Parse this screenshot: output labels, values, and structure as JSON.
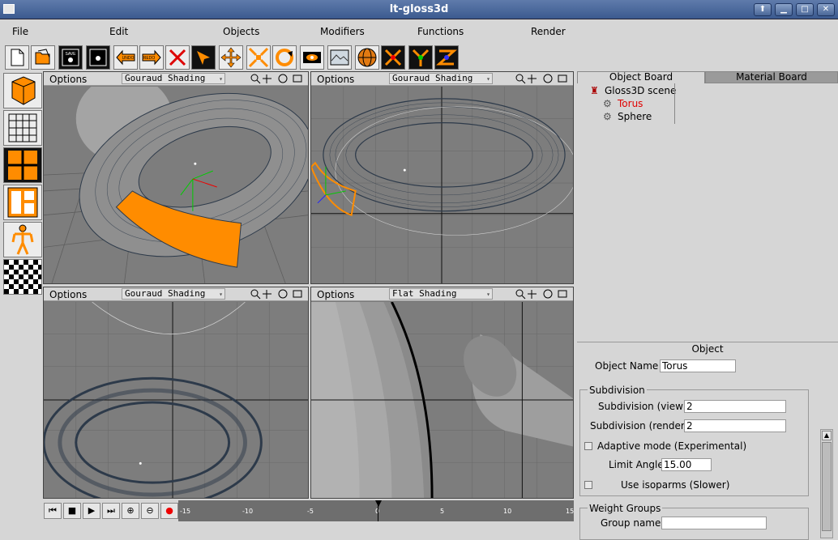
{
  "window": {
    "title": "lt-gloss3d"
  },
  "menubar": {
    "items": [
      "File",
      "Edit",
      "Objects",
      "Modifiers",
      "Functions",
      "Render"
    ]
  },
  "toolbar": {
    "icons": [
      "new-file-icon",
      "open-file-icon",
      "save-file-icon",
      "save-as-icon",
      "undo-icon",
      "redo-icon",
      "delete-icon",
      "pick-icon",
      "move-icon",
      "scale-icon",
      "rotate-icon",
      "render-view-icon",
      "render-final-icon",
      "sphere-render-icon",
      "x-axis-icon",
      "y-axis-icon",
      "z-axis-icon"
    ],
    "undo_label": "UNDO",
    "redo_label": "REDO",
    "save_label": "SAVE"
  },
  "lefttools": {
    "icons": [
      "box-primitive-icon",
      "grid-view-icon",
      "four-views-icon",
      "layout-views-icon",
      "skeleton-icon",
      "checker-material-icon"
    ]
  },
  "viewports": [
    {
      "options": "Options",
      "shading": "Gouraud Shading"
    },
    {
      "options": "Options",
      "shading": "Gouraud Shading"
    },
    {
      "options": "Options",
      "shading": "Gouraud Shading"
    },
    {
      "options": "Options",
      "shading": "Flat Shading"
    }
  ],
  "timeline": {
    "ticks": [
      "-15",
      "-10",
      "-5",
      "0",
      "5",
      "10",
      "15"
    ]
  },
  "rightpanel": {
    "tabs": [
      "Object Board",
      "Material Board"
    ],
    "tree": {
      "scene": "Gloss3D scene",
      "items": [
        "Torus",
        "Sphere"
      ]
    },
    "object": {
      "header": "Object",
      "name_label": "Object Name",
      "name_value": "Torus",
      "subdivision_title": "Subdivision",
      "subdiv_view_label": "Subdivision (view)",
      "subdiv_view_value": "2",
      "subdiv_render_label": "Subdivision (render)",
      "subdiv_render_value": "2",
      "adaptive_label": "Adaptive mode (Experimental)",
      "limit_angle_label": "Limit Angle",
      "limit_angle_value": "15.00",
      "isoparms_label": "Use isoparms (Slower)",
      "weight_groups_title": "Weight Groups",
      "group_name_label": "Group name",
      "group_name_value": ""
    }
  },
  "colors": {
    "selection": "#ff8c00",
    "viewport_bg": "#7a7a7a",
    "title_bar": "#4a6798",
    "selected_item": "#e00000"
  }
}
